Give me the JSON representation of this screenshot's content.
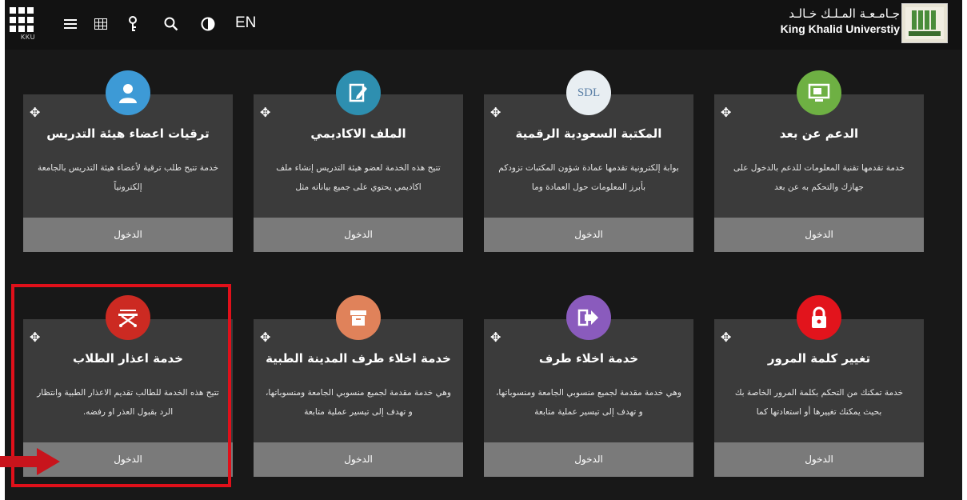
{
  "topbar": {
    "logo_text": "KKU",
    "icons": [
      "menu-icon",
      "grid-icon",
      "key-icon",
      "search-icon",
      "contrast-icon"
    ],
    "lang": "EN",
    "university_ar": "جـامـعـة المـلـك خـالـد",
    "university_en": "King Khalid Universtiy"
  },
  "cards": [
    {
      "title": "الدعم عن بعد",
      "desc": "خدمة تقدمها تقنية المعلومات للدعم بالدخول على جهازك والتحكم به عن بعد",
      "button": "الدخول",
      "icon": "remote-support-icon",
      "color": "#6eb043"
    },
    {
      "title": "المكتبة السعودية الرقمية",
      "desc": "بوابة إلكترونية تقدمها عمادة شؤون المكتبات تزودكم بأبرز المعلومات حول العمادة وما",
      "button": "الدخول",
      "icon": "sdl-logo",
      "icon_text": "SDL",
      "color": "#e8eef2"
    },
    {
      "title": "الملف الاكاديمي",
      "desc": "تتيح هذه الخدمة لعضو هيئة التدريس إنشاء ملف اكاديمي يحتوي على جميع بياناته مثل",
      "button": "الدخول",
      "icon": "edit-document-icon",
      "color": "#2e8fb0"
    },
    {
      "title": "ترقيات اعضاء هيئة التدريس",
      "desc": "خدمة تتيح طلب ترقية لأعضاء هيئة التدريس بالجامعة إلكترونياً",
      "button": "الدخول",
      "icon": "faculty-icon",
      "color": "#3d9ad6"
    },
    {
      "title": "تغيير كلمة المرور",
      "desc": "خدمة تمكنك من التحكم بكلمة المرور الخاصة بك بحيث يمكنك تغييرها أو استعادتها كما",
      "button": "الدخول",
      "icon": "lock-icon",
      "color": "#e2141c"
    },
    {
      "title": "خدمة اخلاء طرف",
      "desc": "وهي خدمة مقدمة لجميع منسوبي الجامعة ومنسوباتها، و تهدف إلى تيسير عملية متابعة",
      "button": "الدخول",
      "icon": "exit-icon",
      "color": "#8a5bbd"
    },
    {
      "title": "خدمة اخلاء طرف المدينة الطبية",
      "desc": "وهي خدمة مقدمة لجميع منسوبي الجامعة ومنسوباتها، و تهدف إلى تيسير عملية متابعة",
      "button": "الدخول",
      "icon": "archive-icon",
      "color": "#e0825a"
    },
    {
      "title": "خدمة اعذار الطلاب",
      "desc": "تتيح هذه الخدمة للطالب تقديم الاعذار الطبية وانتظار الرد بقبول العذر او رفضه.",
      "button": "الدخول",
      "icon": "stretcher-icon",
      "color": "#cc2a22"
    }
  ],
  "annotation": {
    "highlight_color": "#e0101a",
    "arrow_color": "#c8141c"
  }
}
